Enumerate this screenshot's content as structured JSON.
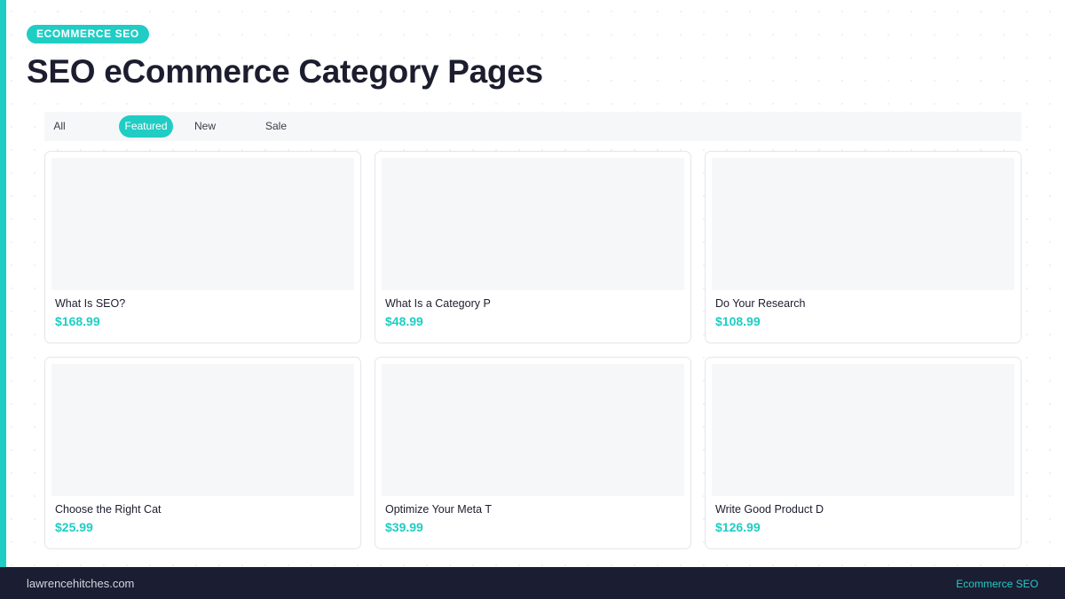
{
  "header": {
    "badge": "ECOMMERCE SEO",
    "title": "SEO eCommerce Category Pages"
  },
  "filters": {
    "active": "Featured",
    "tabs": [
      {
        "label": "All"
      },
      {
        "label": "Featured"
      },
      {
        "label": "New"
      },
      {
        "label": "Sale"
      }
    ]
  },
  "products": [
    {
      "title": "What Is SEO?",
      "price": "$168.99"
    },
    {
      "title": "What Is a Category P",
      "price": "$48.99"
    },
    {
      "title": "Do Your Research",
      "price": "$108.99"
    },
    {
      "title": "Choose the Right Cat",
      "price": "$25.99"
    },
    {
      "title": "Optimize Your Meta T",
      "price": "$39.99"
    },
    {
      "title": "Write Good Product D",
      "price": "$126.99"
    }
  ],
  "footer": {
    "site": "lawrencehitches.com",
    "section": "Ecommerce SEO"
  },
  "colors": {
    "accent": "#1fcdc4",
    "dark": "#1b1d33",
    "text": "#1c1d2e"
  }
}
